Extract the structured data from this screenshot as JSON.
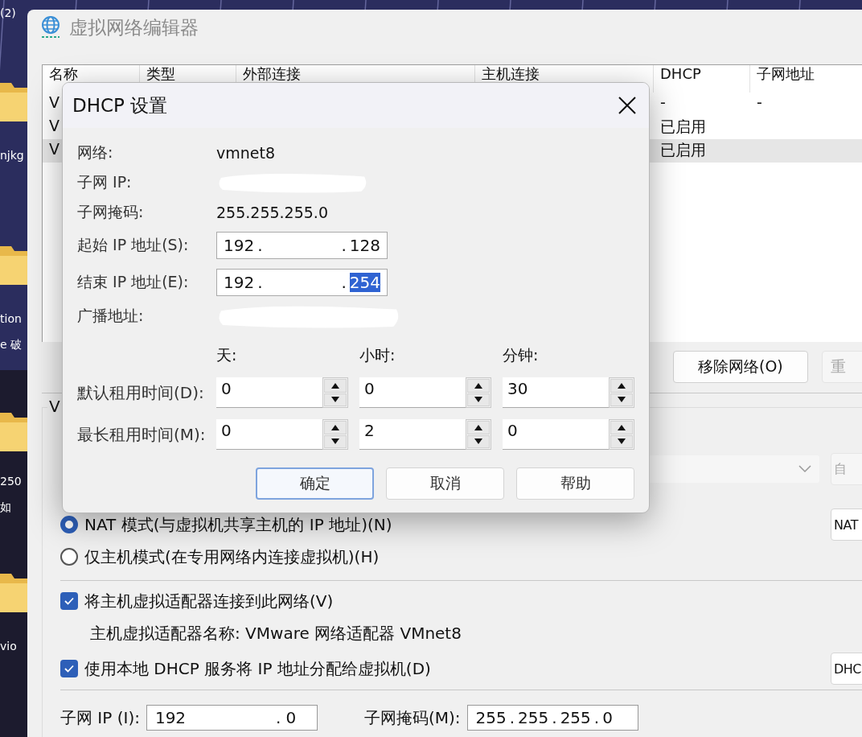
{
  "desktop": {
    "items": [
      {
        "kind": "label",
        "text": "(2)"
      },
      {
        "kind": "folder"
      },
      {
        "kind": "label",
        "text": "njkg"
      },
      {
        "kind": "folder"
      },
      {
        "kind": "label",
        "text": "tion"
      },
      {
        "kind": "label",
        "text": "e 破"
      },
      {
        "kind": "folder"
      },
      {
        "kind": "label",
        "text": "250"
      },
      {
        "kind": "label",
        "text": "如"
      },
      {
        "kind": "folder"
      },
      {
        "kind": "label",
        "text": "vio"
      }
    ]
  },
  "window": {
    "title": "虚拟网络编辑器",
    "table": {
      "columns": [
        "名称",
        "类型",
        "外部连接",
        "主机连接",
        "DHCP",
        "子网地址"
      ],
      "rows": [
        {
          "name": "V",
          "dhcp": "-",
          "subnet": "-",
          "selected": false
        },
        {
          "name": "V",
          "dhcp": "已启用",
          "selected": false
        },
        {
          "name": "V",
          "dhcp": "已启用",
          "selected": true
        }
      ]
    },
    "buttons": [
      {
        "label": "移除网络(O)",
        "disabled": false
      },
      {
        "label": "重",
        "disabled": true
      }
    ],
    "vmnet_info": {
      "label": "V",
      "adapter_select": {
        "disabled": true
      },
      "auto_button": {
        "label": "自",
        "disabled": true
      },
      "modes": [
        {
          "label": "NAT 模式(与虚拟机共享主机的 IP 地址)(N)",
          "selected": true
        },
        {
          "label": "仅主机模式(在专用网络内连接虚拟机)(H)",
          "selected": false
        }
      ],
      "nat_button": "NAT",
      "connect_adapter": {
        "label": "将主机虚拟适配器连接到此网络(V)",
        "checked": true
      },
      "adapter_name": "主机虚拟适配器名称: VMware 网络适配器 VMnet8",
      "use_dhcp": {
        "label": "使用本地 DHCP 服务将 IP 地址分配给虚拟机(D)",
        "checked": true
      },
      "dhcp_button": "DHC",
      "subnet_ip": {
        "label": "子网 IP (I):",
        "first": "192",
        "last": "0",
        "separator": "."
      },
      "subnet_mask": {
        "label": "子网掩码(M):",
        "octets": [
          "255",
          "255",
          "255",
          "0"
        ],
        "separator": "."
      }
    }
  },
  "dialog": {
    "title": "DHCP 设置",
    "info": [
      {
        "label": "网络:",
        "value": "vmnet8"
      },
      {
        "label": "子网 IP:"
      },
      {
        "label": "子网掩码:",
        "value": "255.255.255.0"
      }
    ],
    "ip_ranges": [
      {
        "label": "起始 IP 地址(S):",
        "first": "192",
        "last": "128",
        "separator": ".",
        "last_selected": false
      },
      {
        "label": "结束 IP 地址(E):",
        "first": "192",
        "last": "254",
        "separator": ".",
        "last_selected": true
      }
    ],
    "broadcast": {
      "label": "广播地址:"
    },
    "lease_units": [
      "天:",
      "小时:",
      "分钟:"
    ],
    "leases": [
      {
        "label": "默认租用时间(D):",
        "values": [
          "0",
          "0",
          "30"
        ]
      },
      {
        "label": "最长租用时间(M):",
        "values": [
          "0",
          "2",
          "0"
        ]
      }
    ],
    "buttons": [
      {
        "label": "确定",
        "default": true
      },
      {
        "label": "取消",
        "default": false
      },
      {
        "label": "帮助",
        "default": false
      }
    ]
  }
}
